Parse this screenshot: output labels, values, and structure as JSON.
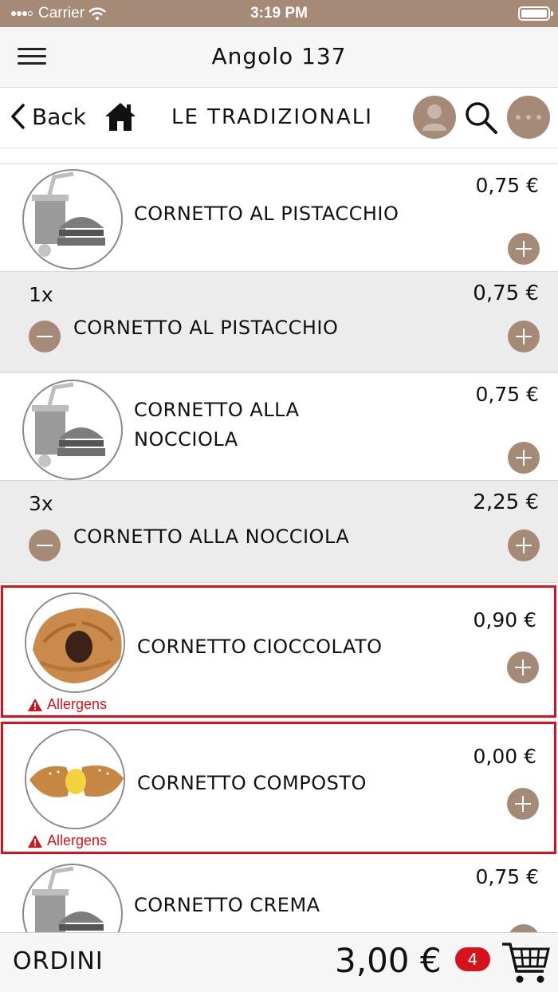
{
  "status": {
    "carrier": "Carrier",
    "time": "3:19 PM"
  },
  "header": {
    "title": "Angolo 137"
  },
  "nav": {
    "back_label": "Back",
    "category": "LE TRADIZIONALI"
  },
  "products": [
    {
      "name": "CORNETTO AL PISTACCHIO",
      "price": "0,75 €",
      "image": "placeholder-food-icon"
    },
    {
      "name": "CORNETTO ALLA NOCCIOLA",
      "price": "0,75 €",
      "image": "placeholder-food-icon"
    },
    {
      "name": "CORNETTO CIOCCOLATO",
      "price": "0,90 €",
      "image": "chocolate-croissant-photo",
      "allergens": "Allergens"
    },
    {
      "name": "CORNETTO COMPOSTO",
      "price": "0,00 €",
      "image": "filled-croissant-photo",
      "allergens": "Allergens"
    },
    {
      "name": "CORNETTO CREMA",
      "price": "0,75 €",
      "image": "placeholder-food-icon"
    }
  ],
  "cart_lines": [
    {
      "qty": "1x",
      "name": "CORNETTO AL PISTACCHIO",
      "price": "0,75 €"
    },
    {
      "qty": "3x",
      "name": "CORNETTO ALLA NOCCIOLA",
      "price": "2,25 €"
    }
  ],
  "footer": {
    "label": "ORDINI",
    "total": "3,00 €",
    "badge": "4"
  },
  "colors": {
    "accent": "#a68a78",
    "alert": "#d6121c",
    "cart_bg": "#ececec"
  }
}
